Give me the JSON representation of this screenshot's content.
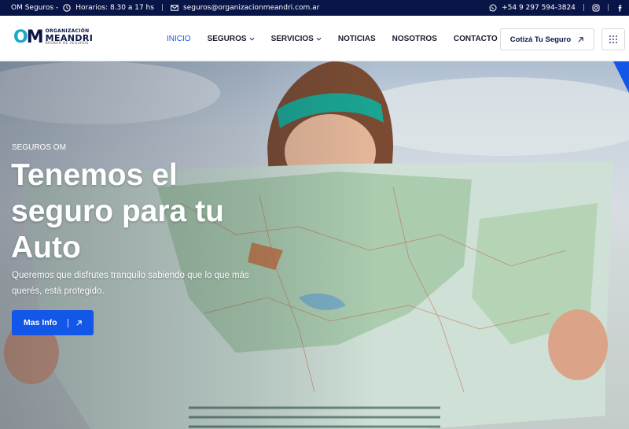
{
  "topbar": {
    "brand": "OM Seguros -",
    "hours": "Horarios: 8.30 a 17 hs",
    "email": "seguros@organizacionmeandri.com.ar",
    "phone": "+54 9 297 594-3824"
  },
  "logo": {
    "mark_o": "O",
    "mark_m": "M",
    "line1": "ORGANIZACIÓN",
    "line2": "MEANDRI",
    "line3": "BROKER DE SEGUROS"
  },
  "nav": {
    "items": [
      {
        "label": "INICIO"
      },
      {
        "label": "SEGUROS"
      },
      {
        "label": "SERVICIOS"
      },
      {
        "label": "NOTICIAS"
      },
      {
        "label": "NOSOTROS"
      },
      {
        "label": "CONTACTO"
      }
    ],
    "cta_label": "Cotizá Tu Seguro"
  },
  "hero": {
    "eyebrow": "SEGUROS OM",
    "headline": "Tenemos el seguro para tu Auto",
    "subtitle": "Queremos que disfrutes tranquilo sabiendo que lo que más querés, está protegido.",
    "button_label": "Mas Info"
  },
  "colors": {
    "topbar_bg": "#0a1547",
    "accent": "#1357e8",
    "logo_teal": "#1aa7c9"
  }
}
